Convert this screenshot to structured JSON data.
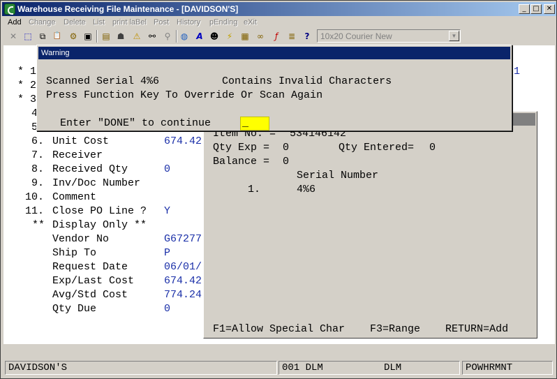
{
  "window": {
    "title": "Warehouse Receiving File Maintenance - [DAVIDSON'S]",
    "minimize": "_",
    "maximize": "□",
    "close": "✕"
  },
  "menu": [
    {
      "label": "Add",
      "enabled": true
    },
    {
      "label": "Change",
      "enabled": false
    },
    {
      "label": "Delete",
      "enabled": false
    },
    {
      "label": "List",
      "enabled": false
    },
    {
      "label": "print laBel",
      "enabled": false
    },
    {
      "label": "Post",
      "enabled": false
    },
    {
      "label": "History",
      "enabled": false
    },
    {
      "label": "pEnding",
      "enabled": false
    },
    {
      "label": "eXit",
      "enabled": false
    }
  ],
  "toolbar": {
    "icons": [
      {
        "name": "cancel-icon",
        "glyph": "✕"
      },
      {
        "name": "select-icon",
        "glyph": "⬚"
      },
      {
        "name": "copy-icon",
        "glyph": "⧉"
      },
      {
        "name": "paste-icon",
        "glyph": "📋"
      },
      {
        "name": "settings-icon",
        "glyph": "⚙"
      },
      {
        "name": "screen-icon",
        "glyph": "▣"
      },
      {
        "name": "notes-icon",
        "glyph": "▤"
      },
      {
        "name": "user-info-icon",
        "glyph": "☗"
      },
      {
        "name": "alert-icon",
        "glyph": "⚠"
      },
      {
        "name": "binoculars-icon",
        "glyph": "⚯"
      },
      {
        "name": "search-icon",
        "glyph": "⚲"
      },
      {
        "name": "globe-icon",
        "glyph": "◍"
      },
      {
        "name": "font-icon",
        "glyph": "A"
      },
      {
        "name": "person-icon",
        "glyph": "☻"
      },
      {
        "name": "lightning-icon",
        "glyph": "⚡"
      },
      {
        "name": "calc-icon",
        "glyph": "▦"
      },
      {
        "name": "link-icon",
        "glyph": "∞"
      },
      {
        "name": "function-icon",
        "glyph": "ƒ"
      },
      {
        "name": "list-icon",
        "glyph": "≣"
      },
      {
        "name": "help-pointer-icon",
        "glyph": "?"
      }
    ],
    "font_selector": "10x20 Courier New"
  },
  "terminal": {
    "left_lines": [
      {
        "num": "* 1",
        "label": "",
        "value": ""
      },
      {
        "num": "* 2",
        "label": "",
        "value": ""
      },
      {
        "num": "* 3",
        "label": "",
        "value": ""
      },
      {
        "num": "4",
        "label": "",
        "value": ""
      },
      {
        "num": "5",
        "label": "",
        "value": ""
      },
      {
        "num": "6.",
        "label": "Unit Cost",
        "value": "674.42"
      },
      {
        "num": "7.",
        "label": "Receiver",
        "value": ""
      },
      {
        "num": "8.",
        "label": "Received Qty",
        "value": "0"
      },
      {
        "num": "9.",
        "label": "Inv/Doc Number",
        "value": ""
      },
      {
        "num": "10.",
        "label": "Comment",
        "value": ""
      },
      {
        "num": "11.",
        "label": "Close PO Line ?",
        "value": "Y"
      },
      {
        "num": "**",
        "label": "Display Only **",
        "value": ""
      },
      {
        "num": "",
        "label": "Vendor No",
        "value": "G67277"
      },
      {
        "num": "",
        "label": "Ship To",
        "value": "P"
      },
      {
        "num": "",
        "label": "Request Date",
        "value": "06/01/"
      },
      {
        "num": "",
        "label": "Exp/Last Cost",
        "value": "674.42"
      },
      {
        "num": "",
        "label": "Avg/Std Cost",
        "value": "774.24"
      },
      {
        "num": "",
        "label": "Qty Due",
        "value": "0"
      }
    ],
    "right_edge_value": "1"
  },
  "serial_panel": {
    "item_label": "Item No. =",
    "item_value": "534146142",
    "qty_exp_label": "Qty Exp =",
    "qty_exp_value": "0",
    "qty_entered_label": "Qty Entered=",
    "qty_entered_value": "0",
    "balance_label": "Balance =",
    "balance_value": "0",
    "serial_header": "Serial Number",
    "rows": [
      {
        "index": "1.",
        "serial": "4%6"
      }
    ],
    "footer": "F1=Allow Special Char    F3=Range    RETURN=Add"
  },
  "dialog": {
    "title": "Warning",
    "line1": "Scanned Serial 4%6          Contains Invalid Characters",
    "line2": "Press Function Key To Override Or Scan Again",
    "prompt": "Enter \"DONE\" to continue",
    "input_value": "_"
  },
  "status": {
    "company": "DAVIDSON'S",
    "location": "001 DLM",
    "user": "DLM",
    "program": "POWHRMNT"
  }
}
